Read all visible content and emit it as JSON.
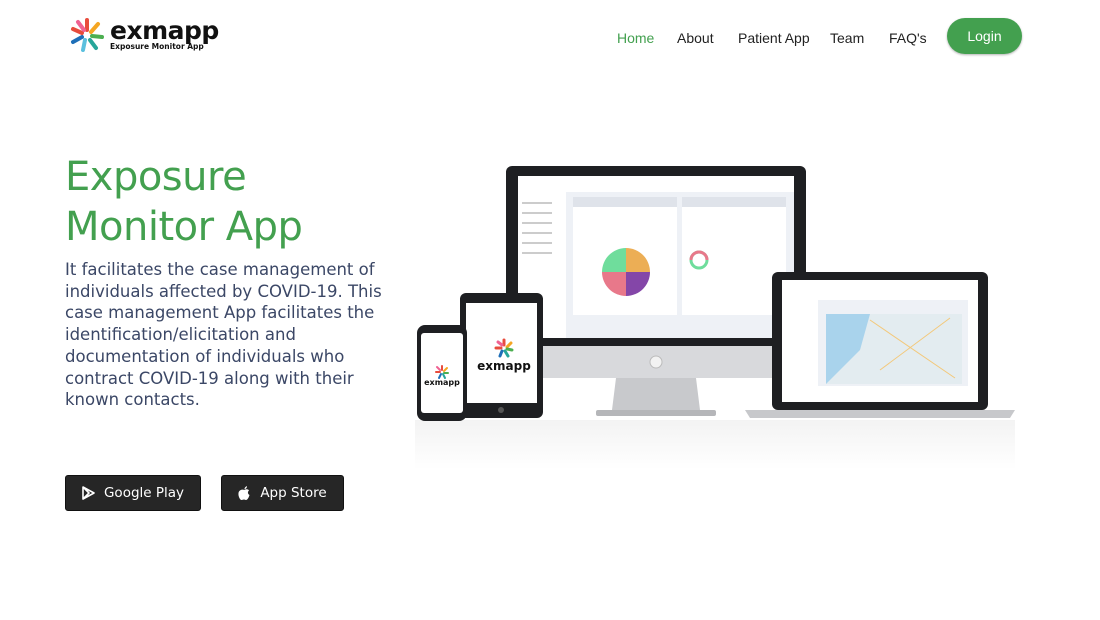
{
  "brand": {
    "name": "exmapp",
    "tagline": "Exposure Monitor App"
  },
  "nav": {
    "items": [
      {
        "label": "Home",
        "active": true
      },
      {
        "label": "About"
      },
      {
        "label": "Patient App"
      },
      {
        "label": "Team"
      },
      {
        "label": "FAQ's"
      }
    ],
    "login": "Login"
  },
  "hero": {
    "title_line1": "Exposure",
    "title_line2": "Monitor App",
    "description": "It facilitates the case management of individuals affected by COVID-19. This case management App facilitates the identification/elicitation and documentation of individuals who contract COVID-19 along with their known contacts.",
    "google_play": "Google Play",
    "app_store": "App Store"
  },
  "colors": {
    "accent": "#43a04f",
    "text": "#3b4766",
    "button_dark": "#262626"
  }
}
